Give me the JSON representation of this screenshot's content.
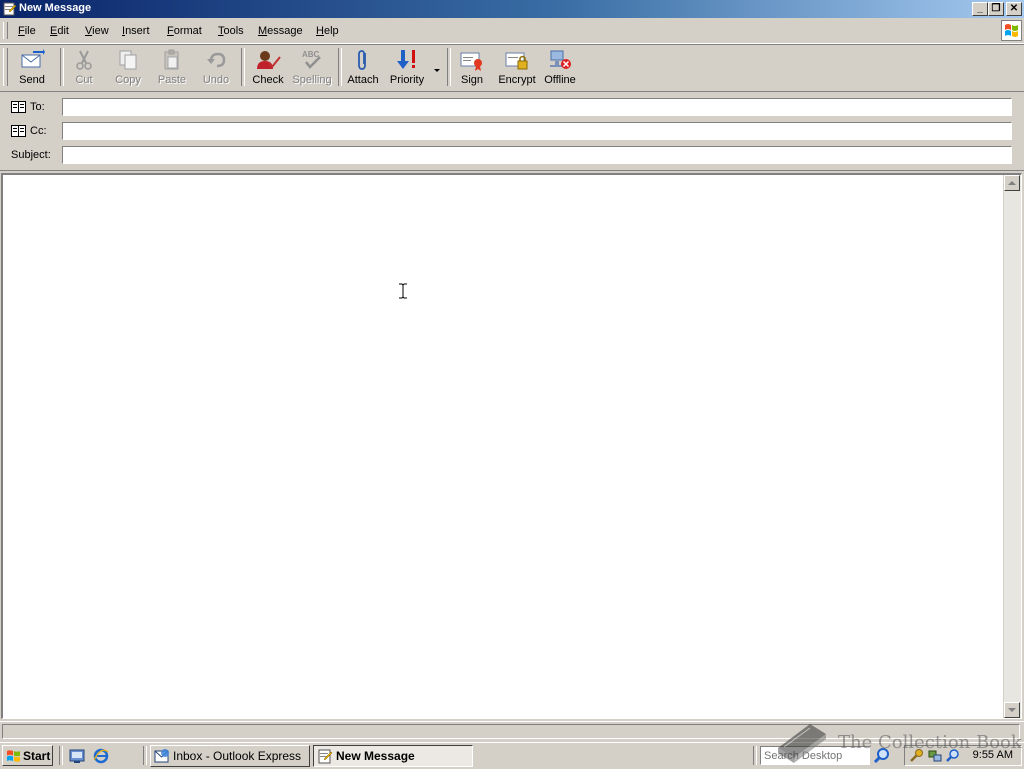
{
  "window": {
    "title": "New Message",
    "controls": {
      "minimize": "_",
      "maximize": "❐",
      "close": "✕"
    }
  },
  "menu": {
    "items": [
      {
        "accel": "F",
        "rest": "ile"
      },
      {
        "accel": "E",
        "rest": "dit"
      },
      {
        "accel": "V",
        "rest": "iew"
      },
      {
        "accel": "I",
        "rest": "nsert"
      },
      {
        "accel": "F",
        "rest": "ormat"
      },
      {
        "accel": "T",
        "rest": "ools"
      },
      {
        "accel": "M",
        "rest": "essage"
      },
      {
        "accel": "H",
        "rest": "elp"
      }
    ]
  },
  "toolbar": {
    "send": "Send",
    "cut": "Cut",
    "copy": "Copy",
    "paste": "Paste",
    "undo": "Undo",
    "check": "Check",
    "spelling": "Spelling",
    "attach": "Attach",
    "priority": "Priority",
    "sign": "Sign",
    "encrypt": "Encrypt",
    "offline": "Offline",
    "disabled": [
      "cut",
      "copy",
      "paste",
      "undo",
      "spelling"
    ]
  },
  "headers": {
    "to": {
      "label": "To:",
      "value": ""
    },
    "cc": {
      "label": "Cc:",
      "value": ""
    },
    "subject": {
      "label": "Subject:",
      "value": ""
    }
  },
  "body": {
    "text": ""
  },
  "taskbar": {
    "start": "Start",
    "tasks": [
      {
        "label": "Inbox - Outlook Express",
        "active": false
      },
      {
        "label": "New Message",
        "active": true
      }
    ],
    "search_placeholder": "Search Desktop",
    "clock": "9:55 AM"
  },
  "watermark": {
    "text": "The Collection Book"
  },
  "colors": {
    "title_start": "#0a246a",
    "title_end": "#a6caf0",
    "face": "#d4d0c8"
  }
}
